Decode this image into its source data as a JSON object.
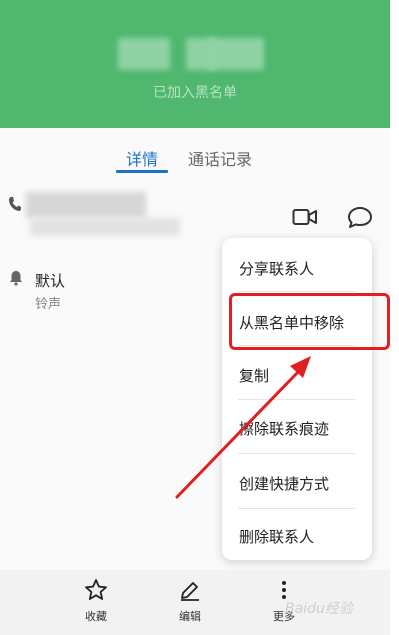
{
  "header": {
    "blocked_status": "已加入黑名单"
  },
  "tabs": [
    {
      "label": "详情",
      "active": true
    },
    {
      "label": "通话记录",
      "active": false
    }
  ],
  "ringtone": {
    "value": "默认",
    "label": "铃声"
  },
  "menu": {
    "items": [
      {
        "label": "分享联系人"
      },
      {
        "label": "从黑名单中移除",
        "highlighted": true
      },
      {
        "label": "复制"
      },
      {
        "label": "擦除联系痕迹"
      },
      {
        "label": "创建快捷方式"
      },
      {
        "label": "删除联系人"
      }
    ]
  },
  "bottom_bar": {
    "favorite_label": "收藏",
    "edit_label": "编辑",
    "more_label": "更多"
  },
  "watermark": "Baidu经验",
  "colors": {
    "header_green": "#4fb86e",
    "accent_blue": "#1c73c9",
    "annotation_red": "#e02020"
  },
  "icons": [
    "phone-icon",
    "video-call-icon",
    "message-icon",
    "bell-icon",
    "star-icon",
    "pencil-icon",
    "more-vertical-icon"
  ]
}
